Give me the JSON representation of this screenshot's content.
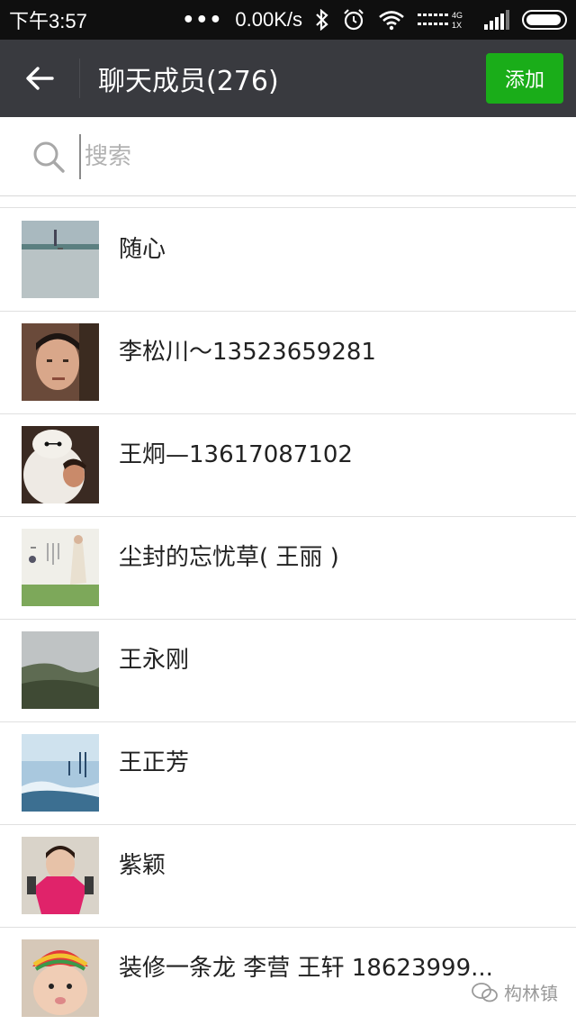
{
  "status_bar": {
    "time": "下午3:57",
    "dots": "•••",
    "speed": "0.00K/s",
    "network_label": "4G 1X",
    "battery_level": 0.95
  },
  "header": {
    "back_icon": "back-arrow-icon",
    "title": "聊天成员(276)",
    "add_label": "添加"
  },
  "search": {
    "placeholder": "搜索",
    "icon": "search-icon"
  },
  "members": [
    {
      "name": "随心"
    },
    {
      "name": "李松川～13523659281"
    },
    {
      "name": "王炯—13617087102"
    },
    {
      "name": "尘封的忘忧草( 王丽 )"
    },
    {
      "name": "王永刚"
    },
    {
      "name": "王正芳"
    },
    {
      "name": "紫颖"
    },
    {
      "name": "装修一条龙 李营 王轩 18623999..."
    }
  ],
  "watermark": {
    "text": "构林镇"
  },
  "colors": {
    "status_bg": "#0f0f0f",
    "header_bg": "#393a3f",
    "accent_green": "#1aad19",
    "divider": "#e0e0e0"
  }
}
